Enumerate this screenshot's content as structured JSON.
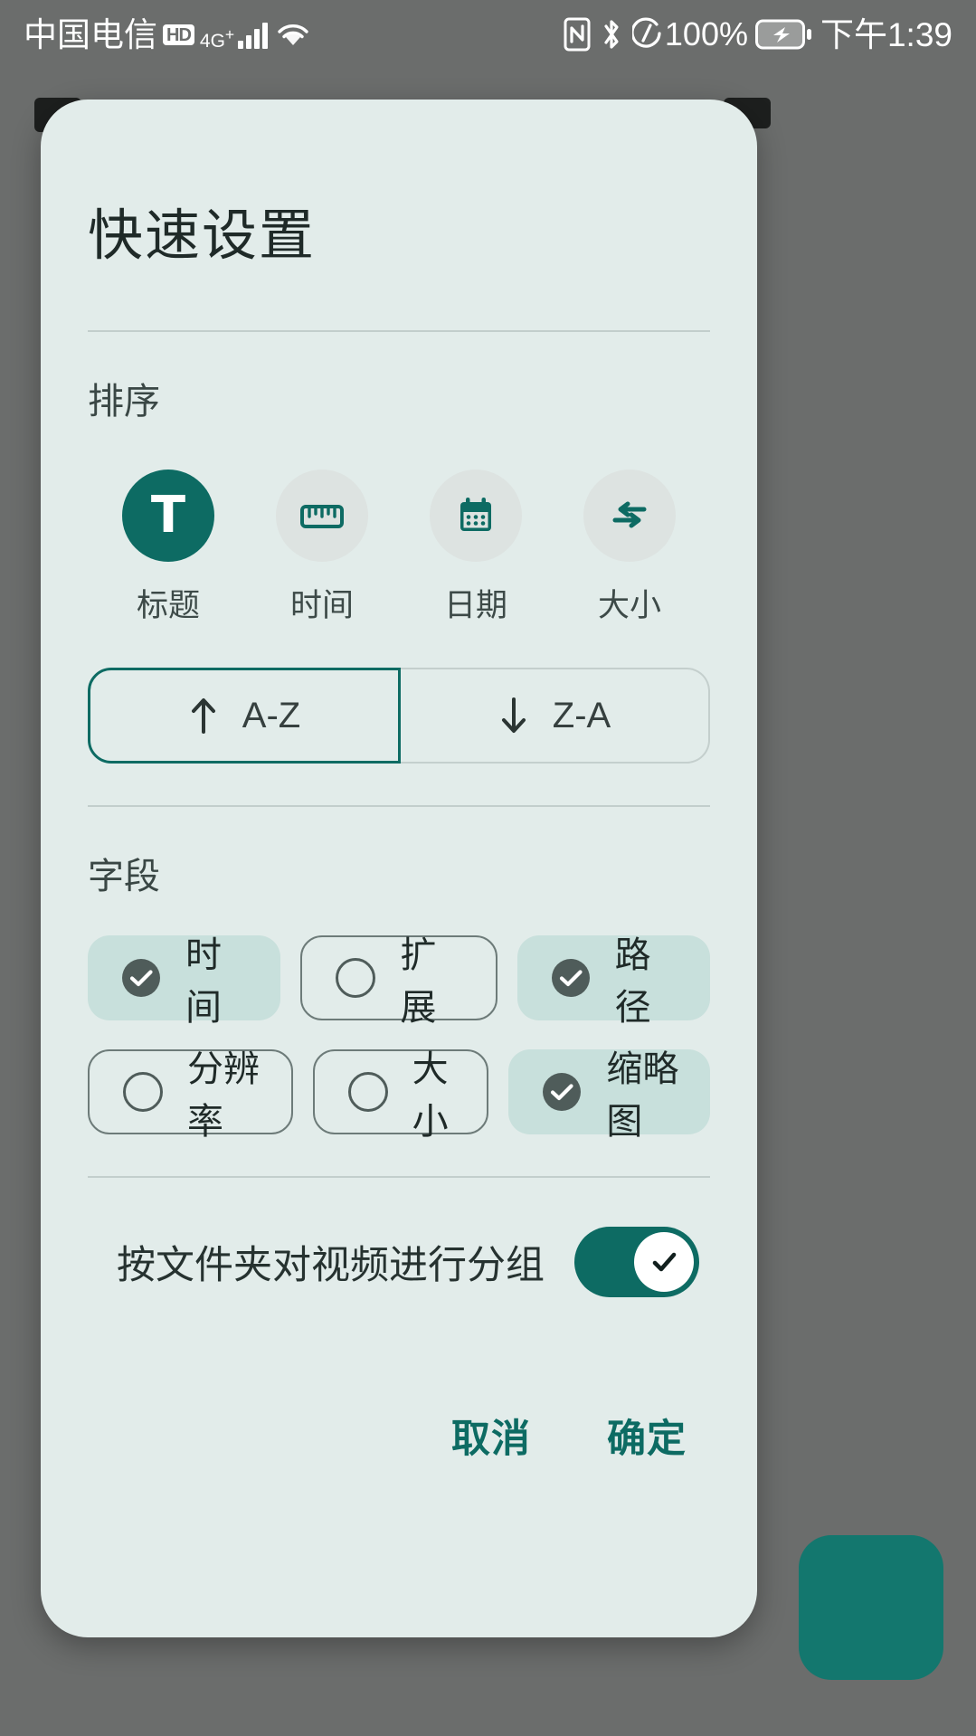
{
  "status_bar": {
    "carrier": "中国电信",
    "hd_badge": "HD",
    "network": "4G",
    "network_sup": "+",
    "battery_percent": "100%",
    "time": "下午1:39",
    "icons": [
      "signal-bars-icon",
      "wifi-icon",
      "nfc-icon",
      "bluetooth-icon",
      "battery-charging-icon"
    ]
  },
  "dialog": {
    "title": "快速设置",
    "sort": {
      "section_label": "排序",
      "options": [
        {
          "label": "标题",
          "icon": "title-letter-icon",
          "selected": true
        },
        {
          "label": "时间",
          "icon": "ruler-icon",
          "selected": false
        },
        {
          "label": "日期",
          "icon": "calendar-icon",
          "selected": false
        },
        {
          "label": "大小",
          "icon": "compress-arrows-icon",
          "selected": false
        }
      ],
      "order": [
        {
          "label": "A-Z",
          "icon": "arrow-up-icon",
          "selected": true
        },
        {
          "label": "Z-A",
          "icon": "arrow-down-icon",
          "selected": false
        }
      ]
    },
    "fields": {
      "section_label": "字段",
      "row1": [
        {
          "label": "时间",
          "checked": true
        },
        {
          "label": "扩展",
          "checked": false
        },
        {
          "label": "路径",
          "checked": true
        }
      ],
      "row2": [
        {
          "label": "分辨率",
          "checked": false
        },
        {
          "label": "大小",
          "checked": false
        },
        {
          "label": "缩略图",
          "checked": true
        }
      ]
    },
    "group_switch": {
      "label": "按文件夹对视频进行分组",
      "on": true
    },
    "footer": {
      "cancel": "取消",
      "confirm": "确定"
    }
  },
  "colors": {
    "accent": "#0d6b63",
    "dialog_bg": "#e2ecea",
    "chip_on_bg": "#c8e0dc",
    "scrim": "#6b6d6c",
    "circle_idle": "#dde3e1",
    "check_gray": "#4f5c5a"
  }
}
